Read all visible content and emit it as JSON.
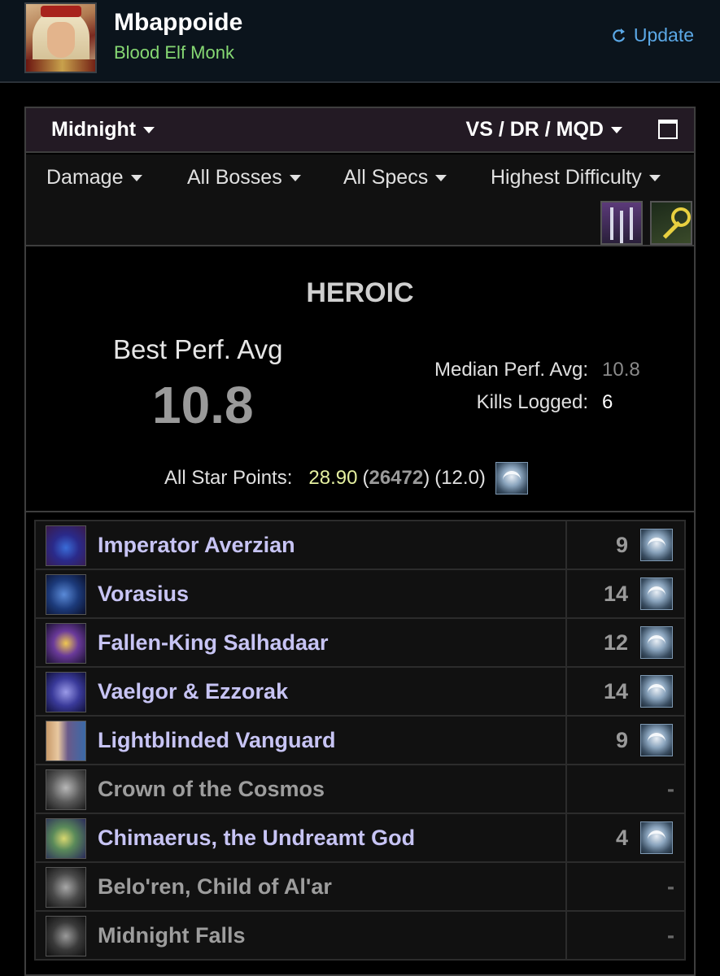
{
  "header": {
    "character_name": "Mbappoide",
    "character_class": "Blood Elf Monk",
    "update_label": "Update"
  },
  "toolbar": {
    "zone": "Midnight",
    "metric_set": "VS / DR / MQD"
  },
  "filters": {
    "metric": "Damage",
    "bosses": "All Bosses",
    "specs": "All Specs",
    "difficulty": "Highest Difficulty"
  },
  "spec_icons": [
    "windwalker-spec-icon",
    "key-icon"
  ],
  "summary": {
    "difficulty": "HEROIC",
    "best_label": "Best Perf. Avg",
    "best_value": "10.8",
    "median_label": "Median Perf. Avg:",
    "median_value": "10.8",
    "kills_label": "Kills Logged:",
    "kills_value": "6",
    "star_label": "All Star Points:",
    "star_points": "28.90",
    "star_rank": "26472",
    "star_extra": "(12.0)"
  },
  "bosses": [
    {
      "name": "Imperator Averzian",
      "score": "9",
      "killed": true
    },
    {
      "name": "Vorasius",
      "score": "14",
      "killed": true
    },
    {
      "name": "Fallen-King Salhadaar",
      "score": "12",
      "killed": true
    },
    {
      "name": "Vaelgor & Ezzorak",
      "score": "14",
      "killed": true
    },
    {
      "name": "Lightblinded Vanguard",
      "score": "9",
      "killed": true
    },
    {
      "name": "Crown of the Cosmos",
      "score": "-",
      "killed": false
    },
    {
      "name": "Chimaerus, the Undreamt God",
      "score": "4",
      "killed": true
    },
    {
      "name": "Belo'ren, Child of Al'ar",
      "score": "-",
      "killed": false
    },
    {
      "name": "Midnight Falls",
      "score": "-",
      "killed": false
    }
  ],
  "colors": {
    "accent_link": "#5ba8e6",
    "class_text": "#86d873",
    "boss_killed": "#c7c4f4",
    "boss_unkilled": "#9d9d9d",
    "star_points": "#e5f0a0"
  }
}
